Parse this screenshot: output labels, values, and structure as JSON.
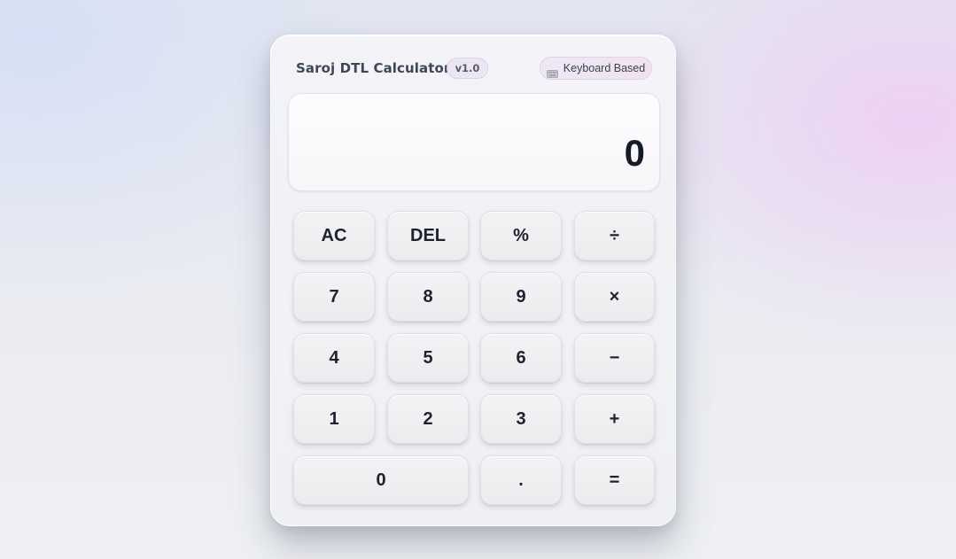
{
  "header": {
    "title": "Saroj DTL Calculator",
    "version": "v1.0",
    "mode_label": "Keyboard Based",
    "mode_icon": "keyboard-icon"
  },
  "display": {
    "value": "0"
  },
  "keypad": {
    "rows": [
      [
        "AC",
        "DEL",
        "%",
        "÷"
      ],
      [
        "7",
        "8",
        "9",
        "×"
      ],
      [
        "4",
        "5",
        "6",
        "−"
      ],
      [
        "1",
        "2",
        "3",
        "+"
      ],
      [
        "0",
        ".",
        "="
      ]
    ]
  },
  "colors": {
    "display_text": "#161a28",
    "key_text": "#1d2130",
    "badge_bg": "#ece6f4",
    "keyboard_badge_bg": "#f2e2ef"
  }
}
